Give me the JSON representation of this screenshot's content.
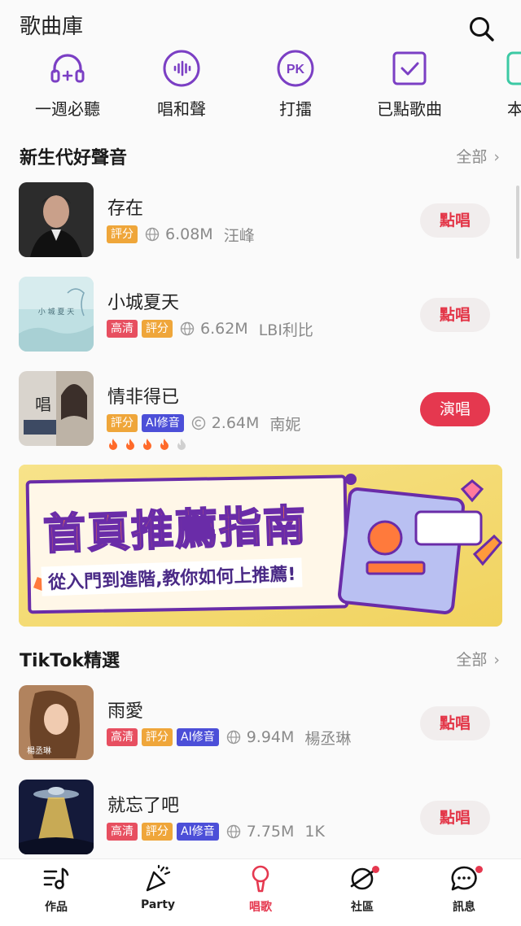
{
  "header": {
    "title": "歌曲庫"
  },
  "quick_actions": [
    {
      "label": "一週必聽",
      "icon": "headphones-icon"
    },
    {
      "label": "唱和聲",
      "icon": "voice-wave-icon"
    },
    {
      "label": "打擂",
      "icon": "pk-icon",
      "icon_text": "PK"
    },
    {
      "label": "已點歌曲",
      "icon": "checkbox-icon"
    },
    {
      "label": "本地",
      "icon": "local-icon"
    }
  ],
  "section_new": {
    "title": "新生代好聲音",
    "more": "全部",
    "songs": [
      {
        "title": "存在",
        "tags": [
          "評分"
        ],
        "count": "6.08M",
        "artist": "汪峰",
        "button": "點唱"
      },
      {
        "title": "小城夏天",
        "tags": [
          "高清",
          "評分"
        ],
        "count": "6.62M",
        "artist": "LBI利比",
        "button": "點唱"
      },
      {
        "title": "情非得已",
        "tags": [
          "評分",
          "AI修音"
        ],
        "count": "2.64M",
        "artist": "南妮",
        "button": "演唱",
        "flames": 4,
        "flames_total": 5
      }
    ]
  },
  "banner": {
    "title": "首頁推薦指南",
    "subtitle": "從入門到進階,教你如何上推薦!"
  },
  "section_tiktok": {
    "title": "TikTok精選",
    "more": "全部",
    "songs": [
      {
        "title": "雨愛",
        "tags": [
          "高清",
          "評分",
          "AI修音"
        ],
        "count": "9.94M",
        "artist": "楊丞琳",
        "button": "點唱"
      },
      {
        "title": "就忘了吧",
        "tags": [
          "高清",
          "評分",
          "AI修音"
        ],
        "count": "7.75M",
        "artist": "1K",
        "button": "點唱"
      }
    ]
  },
  "tabbar": [
    {
      "label": "作品",
      "icon": "music-list-icon",
      "active": false
    },
    {
      "label": "Party",
      "icon": "party-popper-icon",
      "active": false
    },
    {
      "label": "唱歌",
      "icon": "microphone-icon",
      "active": true
    },
    {
      "label": "社區",
      "icon": "planet-icon",
      "active": false,
      "badge": true
    },
    {
      "label": "訊息",
      "icon": "chat-bubble-icon",
      "active": false,
      "badge": true
    }
  ],
  "colors": {
    "accent": "#e5384f",
    "tag_hd": "#e74f60",
    "tag_score": "#efa63a",
    "tag_ai": "#4c4fd8",
    "icon_purple": "#7b3fc4",
    "icon_teal": "#3cc9a4"
  }
}
